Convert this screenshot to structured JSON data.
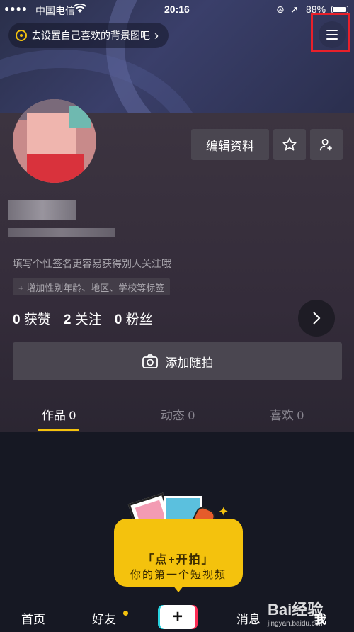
{
  "status": {
    "carrier": "中国电信",
    "time": "20:16",
    "battery": "88%"
  },
  "banner": {
    "text": "去设置自己喜欢的背景图吧",
    "chevron": "›"
  },
  "profile": {
    "edit_label": "编辑资料",
    "bio": "填写个性签名更容易获得别人关注哦",
    "tag": "+ 增加性别年龄、地区、学校等标签"
  },
  "stats": [
    {
      "count": "0",
      "label": "获赞"
    },
    {
      "count": "2",
      "label": "关注"
    },
    {
      "count": "0",
      "label": "粉丝"
    }
  ],
  "add_post": "添加随拍",
  "tabs": [
    {
      "label": "作品 0"
    },
    {
      "label": "动态 0"
    },
    {
      "label": "喜欢 0"
    }
  ],
  "promo": {
    "line1": "「点+开拍」",
    "line2": "你的第一个短视频"
  },
  "nav": {
    "home": "首页",
    "friends": "好友",
    "plus": "+",
    "messages": "消息",
    "me": "我"
  },
  "watermark": {
    "brand": "Bai经验",
    "url": "jingyan.baidu.com"
  },
  "colors": {
    "accent": "#f4c20d",
    "highlight_frame": "#e8202a",
    "background": "#161823"
  }
}
